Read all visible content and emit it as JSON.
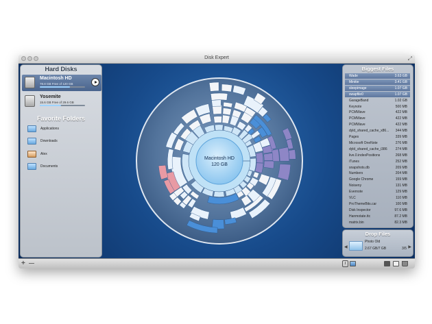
{
  "window": {
    "title": "Disk Expert"
  },
  "hard_disks": {
    "title": "Hard Disks",
    "items": [
      {
        "name": "Macintosh HD",
        "info": "78.8 GB Free of 120 GB",
        "used_fraction": 0.66,
        "selected": true
      },
      {
        "name": "Yosemite",
        "info": "15.6 GB Free of 29.6 GB",
        "used_fraction": 0.47,
        "selected": false
      }
    ]
  },
  "favorites": {
    "title": "Favorite Folders",
    "items": [
      {
        "label": "Applications",
        "icon": "folder-icon"
      },
      {
        "label": "Downloads",
        "icon": "folder-icon"
      },
      {
        "label": "Alex",
        "icon": "home-icon"
      },
      {
        "label": "Documents",
        "icon": "folder-icon"
      }
    ]
  },
  "sunburst": {
    "center_name": "Macintosh HD",
    "center_size": "120 GB"
  },
  "biggest_files": {
    "title": "Biggest Files",
    "items": [
      {
        "name": "Wade",
        "size": "3.63 GB"
      },
      {
        "name": "Minitie",
        "size": "3.41 GB"
      },
      {
        "name": "sleepimage",
        "size": "1.07 GB"
      },
      {
        "name": "swapfile0",
        "size": "1.07 GB"
      },
      {
        "name": "GarageBand",
        "size": "1.02 GB"
      },
      {
        "name": "Keynote",
        "size": "500 MB"
      },
      {
        "name": "PCMWave",
        "size": "422 MB"
      },
      {
        "name": "PCMWave",
        "size": "422 MB"
      },
      {
        "name": "PCMWave",
        "size": "422 MB"
      },
      {
        "name": "dyld_shared_cache_x86...",
        "size": "344 MB"
      },
      {
        "name": "Pages",
        "size": "339 MB"
      },
      {
        "name": "Microsoft OneNote",
        "size": "276 MB"
      },
      {
        "name": "dyld_shared_cache_i386",
        "size": "274 MB"
      },
      {
        "name": "live.0.indexPositions",
        "size": "268 MB"
      },
      {
        "name": "iTunes",
        "size": "252 MB"
      },
      {
        "name": "snapshots.db",
        "size": "209 MB"
      },
      {
        "name": "Numbers",
        "size": "204 MB"
      },
      {
        "name": "Google Chrome",
        "size": "159 MB"
      },
      {
        "name": "Noiseny",
        "size": "131 MB"
      },
      {
        "name": "Evernote",
        "size": "129 MB"
      },
      {
        "name": "VLC",
        "size": "110 MB"
      },
      {
        "name": "ProThemeBits.car",
        "size": "100 MB"
      },
      {
        "name": "Disk Inspector",
        "size": "97.6 MB"
      },
      {
        "name": "Hanmotate.ttc",
        "size": "87.2 MB"
      },
      {
        "name": "matrix.bin",
        "size": "82.3 MB"
      }
    ]
  },
  "drop_files": {
    "title": "Drop Files",
    "item_name": "Photo Old",
    "item_size": "2.67 GB/7 GB",
    "page": "3/5"
  },
  "toolbar": {
    "add": "+",
    "remove": "—",
    "info": "i"
  },
  "colors": {
    "accent_blue": "#4a8fd8",
    "pink": "#e89aa4",
    "purple": "#8e86c6",
    "white_segment": "#f3f5f8",
    "panel_selection": "#5e779e"
  }
}
